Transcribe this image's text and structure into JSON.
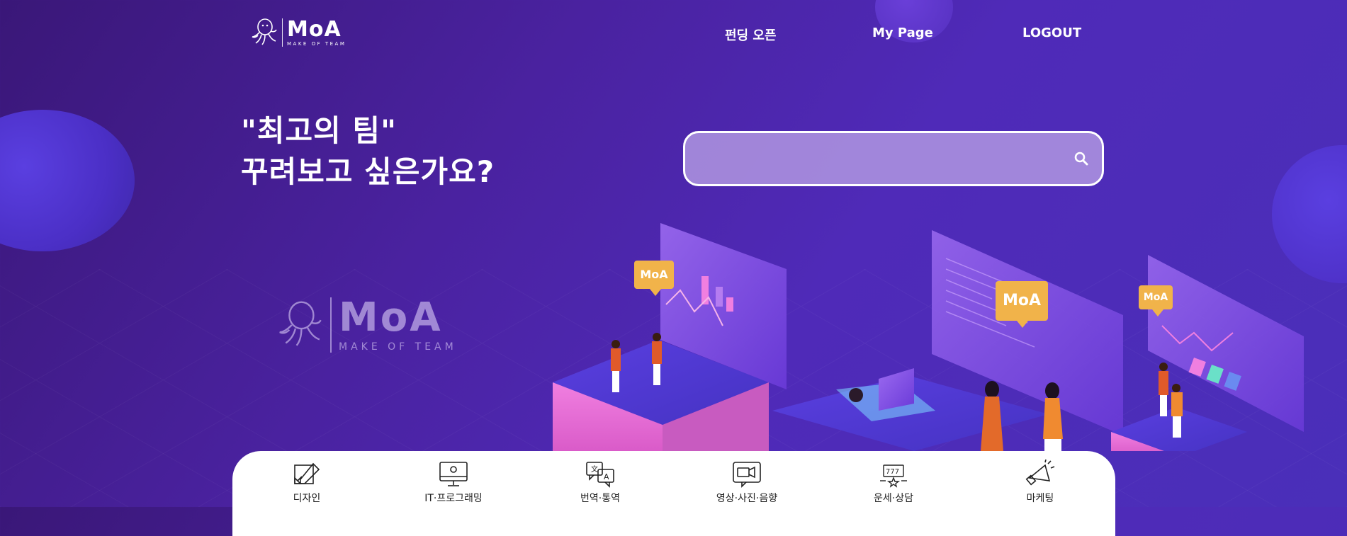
{
  "colors": {
    "background": "#4a22a0",
    "accent_orange": "#f1b34a",
    "accent_pink": "#e36bd4",
    "search_fill": "#b9a0e6",
    "white": "#ffffff"
  },
  "header": {
    "logo": {
      "name": "MoA",
      "tagline": "MAKE OF TEAM"
    },
    "nav": [
      {
        "label": "펀딩 오픈"
      },
      {
        "label": "My Page"
      },
      {
        "label": "LOGOUT"
      }
    ]
  },
  "hero": {
    "line1": "\"최고의 팀\"",
    "line2": "꾸려보고 싶은가요?"
  },
  "search": {
    "placeholder": "",
    "icon": "search-icon"
  },
  "watermark": {
    "name": "MoA",
    "tagline": "MAKE OF TEAM"
  },
  "illustration": {
    "badges": [
      "MoA",
      "MoA",
      "MoA"
    ]
  },
  "categories": [
    {
      "label": "디자인",
      "icon": "design-icon"
    },
    {
      "label": "IT·프로그래밍",
      "icon": "monitor-icon"
    },
    {
      "label": "번역·통역",
      "icon": "translate-icon"
    },
    {
      "label": "영상·사진·음향",
      "icon": "video-icon"
    },
    {
      "label": "운세·상담",
      "icon": "fortune-icon"
    },
    {
      "label": "마케팅",
      "icon": "megaphone-icon"
    }
  ]
}
